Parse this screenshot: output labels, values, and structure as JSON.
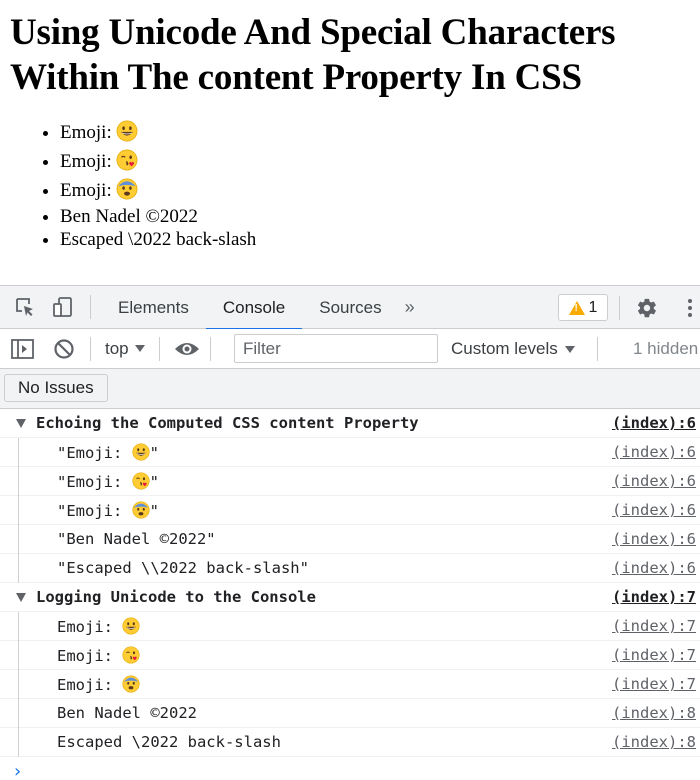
{
  "page": {
    "title_line1": "Using Unicode And Special Characters",
    "title_line2": "Within The content Property In CSS",
    "list": [
      {
        "label": "Emoji: ",
        "emoji": "grinning-face"
      },
      {
        "label": "Emoji: ",
        "emoji": "face-blowing-kiss"
      },
      {
        "label": "Emoji: ",
        "emoji": "fearful-face"
      },
      {
        "text": "Ben Nadel ©2022"
      },
      {
        "text": "Escaped \\2022 back-slash"
      }
    ]
  },
  "devtools": {
    "tabs": [
      "Elements",
      "Console",
      "Sources"
    ],
    "active_tab": "Console",
    "more_tabs": "»",
    "warnings_count": "1",
    "context": "top",
    "filter_placeholder": "Filter",
    "levels_label": "Custom levels",
    "hidden_label": "1 hidden",
    "issues_label": "No Issues",
    "prompt": "›"
  },
  "console": {
    "group1": {
      "title": "Echoing the Computed CSS content Property",
      "src": "(index):6",
      "rows": [
        {
          "pre": "\"Emoji: ",
          "emoji": "grinning-face",
          "post": "\"",
          "src": "(index):6"
        },
        {
          "pre": "\"Emoji: ",
          "emoji": "face-blowing-kiss",
          "post": "\"",
          "src": "(index):6"
        },
        {
          "pre": "\"Emoji: ",
          "emoji": "fearful-face",
          "post": "\"",
          "src": "(index):6"
        },
        {
          "text": "\"Ben Nadel ©2022\"",
          "src": "(index):6"
        },
        {
          "text": "\"Escaped \\\\2022 back-slash\"",
          "src": "(index):6"
        }
      ]
    },
    "group2": {
      "title": "Logging Unicode to the Console",
      "src": "(index):7",
      "rows": [
        {
          "pre": "Emoji: ",
          "emoji": "grinning-face",
          "src": "(index):7"
        },
        {
          "pre": "Emoji: ",
          "emoji": "face-blowing-kiss",
          "src": "(index):7"
        },
        {
          "pre": "Emoji: ",
          "emoji": "fearful-face",
          "src": "(index):7"
        },
        {
          "text": "Ben Nadel ©2022",
          "src": "(index):8"
        },
        {
          "text": "Escaped \\2022 back-slash",
          "src": "(index):8"
        }
      ]
    }
  },
  "colors": {
    "accent": "#1a73e8",
    "warning": "#f9ab00",
    "emoji_yellow": "#ffcc33"
  }
}
